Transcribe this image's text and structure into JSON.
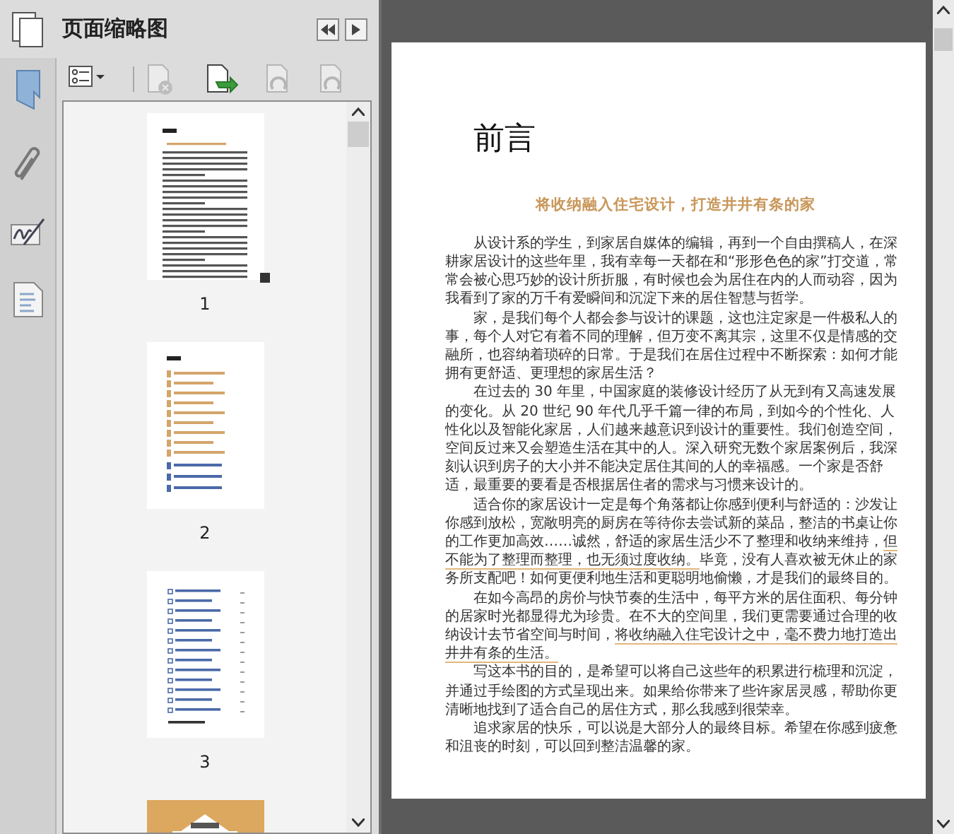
{
  "panel": {
    "title": "页面缩略图"
  },
  "toolbar": [
    {
      "kind": "options",
      "disabled": false
    },
    {
      "kind": "delete",
      "disabled": true
    },
    {
      "kind": "insert",
      "disabled": false
    },
    {
      "kind": "rotate-left",
      "disabled": true
    },
    {
      "kind": "rotate-right",
      "disabled": true
    }
  ],
  "thumbnails": [
    {
      "kind": "picture",
      "label": "1"
    },
    {
      "kind": "picture",
      "label": "2"
    },
    {
      "kind": "picture",
      "label": "3"
    },
    {
      "kind": "picture"
    }
  ],
  "document": {
    "heading": "前言",
    "subtitle": "将收纳融入住宅设计，打造井井有条的家",
    "paragraphs": [
      [
        {
          "text": "从设计系的学生，到家居自媒体的编辑，再到一个自由撰稿人，在深耕家居设计的这些年里，我有幸每一天都在和“形形色色的家”打交道，常常会被心思巧妙的设计所折服，有时候也会为居住在内的人而动容，因为我看到了家的万千有爱瞬间和沉淀下来的居住智慧与哲学。",
          "underlined": false
        }
      ],
      [
        {
          "text": "家，是我们每个人都会参与设计的课题，这也注定家是一件极私人的事，每个人对它有着不同的理解，但万变不离其宗，这里不仅是情感的交融所，也容纳着琐碎的日常。于是我们在居住过程中不断探索：如何才能拥有更舒适、更理想的家居生活？",
          "underlined": false
        }
      ],
      [
        {
          "text": "在过去的 30 年里，中国家庭的装修设计经历了从无到有又高速发展的变化。从 20 世纪 90 年代几乎千篇一律的布局，到如今的个性化、人性化以及智能化家居，人们越来越意识到设计的重要性。我们创造空间，空间反过来又会塑造生活在其中的人。深入研究无数个家居案例后，我深刻认识到房子的大小并不能决定居住其间的人的幸福感。一个家是否舒适，最重要的要看是否根据居住者的需求与习惯来设计的。",
          "underlined": false
        }
      ],
      [
        {
          "text": "适合你的家居设计一定是每个角落都让你感到便利与舒适的：沙发让你感到放松，宽敞明亮的厨房在等待你去尝试新的菜品，整洁的书桌让你的工作更加高效……诚然，舒适的家居生活少不了整理和收纳来维持，",
          "underlined": false
        },
        {
          "text": "但不能为了整理而整理，也无须过度收纳。",
          "underlined": true
        },
        {
          "text": "毕竟，没有人喜欢被无休止的家务所支配吧！如何更便利地生活和更聪明地偷懒，才是我们的最终目的。",
          "underlined": false
        }
      ],
      [
        {
          "text": "在如今高昂的房价与快节奏的生活中，每平方米的居住面积、每分钟的居家时光都显得尤为珍贵。在不大的空间里，我们更需要通过合理的收纳设计去节省空间与时间，",
          "underlined": false
        },
        {
          "text": "将收纳融入住宅设计之中，毫不费力地打造出井井有条的生活。",
          "underlined": true
        }
      ],
      [
        {
          "text": "写这本书的目的，是希望可以将自己这些年的积累进行梳理和沉淀，并通过手绘图的方式呈现出来。如果给你带来了些许家居灵感，帮助你更清晰地找到了适合自己的居住方式，那么我感到很荣幸。",
          "underlined": false
        }
      ],
      [
        {
          "text": "追求家居的快乐，可以说是大部分人的最终目标。希望在你感到疲惫和沮丧的时刻，可以回到整洁温馨的家。",
          "underlined": false
        }
      ]
    ]
  }
}
